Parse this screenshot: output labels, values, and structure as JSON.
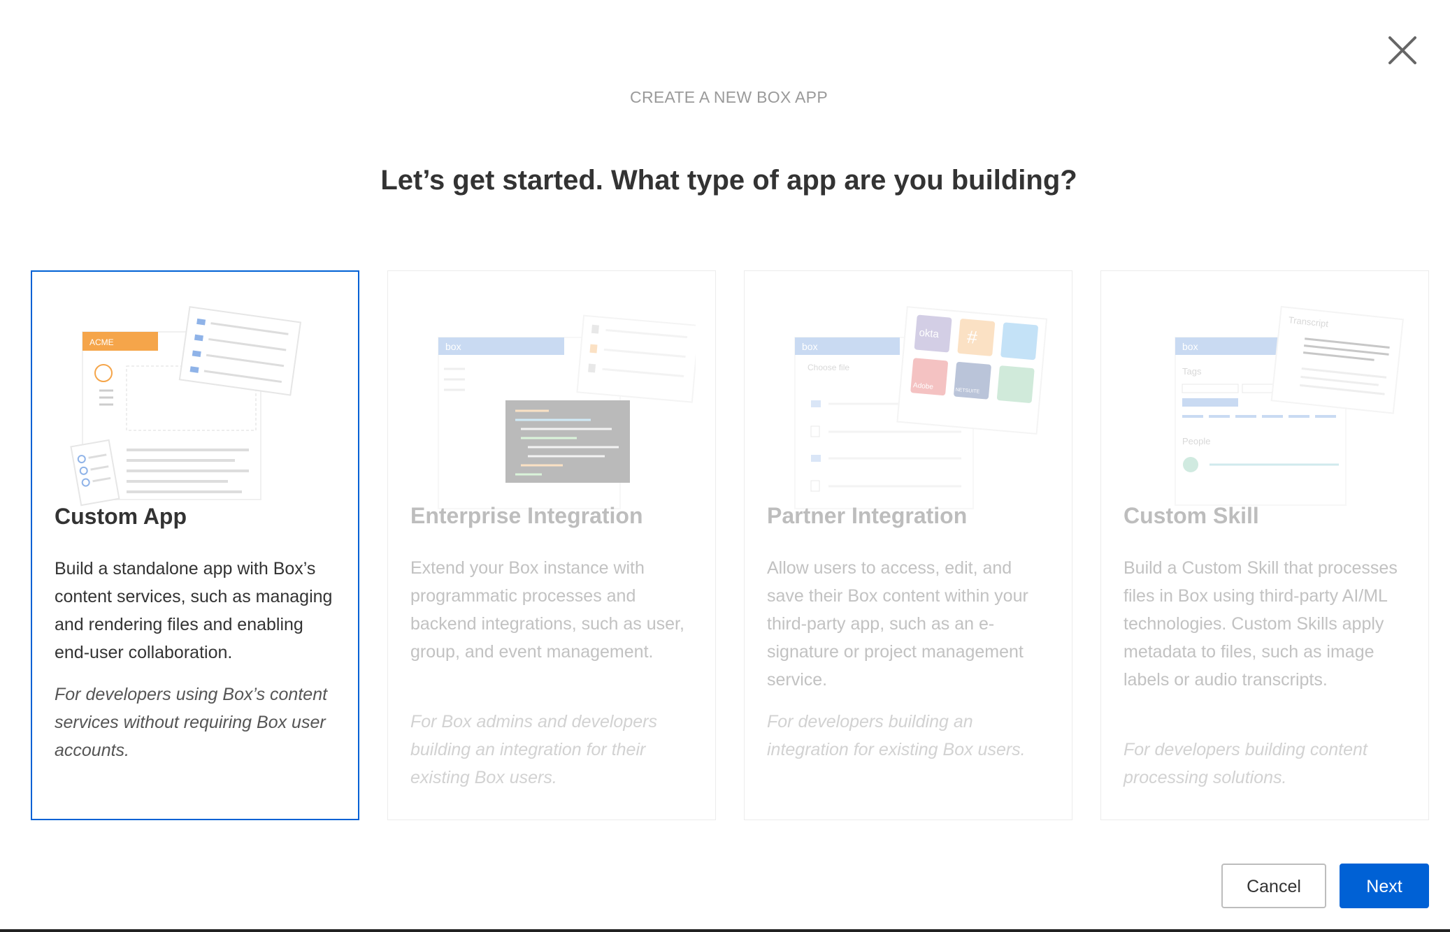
{
  "dialog": {
    "kicker": "CREATE A NEW BOX APP",
    "headline": "Let’s get started. What type of app are you building?",
    "close_icon": "close-icon"
  },
  "cards": [
    {
      "title": "Custom App",
      "description": "Build a standalone app with Box’s content services, such as managing and rendering files and enabling end-user collaboration.",
      "note": "For developers using Box’s content services without requiring Box user accounts.",
      "selected": true,
      "illustration_text": "ACME"
    },
    {
      "title": "Enterprise Integration",
      "description": "Extend your Box instance with programmatic processes and backend integrations, such as user, group, and event management.",
      "note": "For Box admins and developers building an integration for their existing Box users.",
      "selected": false,
      "illustration_text": "box"
    },
    {
      "title": "Partner Integration",
      "description": "Allow users to access, edit, and save their Box content within your third-party app, such as an e-signature or project management service.",
      "note": "For developers building an integration for existing Box users.",
      "selected": false,
      "illustration_text": "box",
      "illustration_labels": [
        "Choose file",
        "okta",
        "Adobe",
        "NETSUITE"
      ]
    },
    {
      "title": "Custom Skill",
      "description": "Build a Custom Skill that processes files in Box using third-party AI/ML technologies. Custom Skills apply metadata to files, such as image labels or audio transcripts.",
      "note": "For developers building content processing solutions.",
      "selected": false,
      "illustration_text": "box",
      "illustration_labels": [
        "Transcript",
        "Tags",
        "People"
      ]
    }
  ],
  "footer": {
    "cancel_label": "Cancel",
    "next_label": "Next"
  },
  "colors": {
    "accent": "#0061d5",
    "acme_orange": "#f5a54a",
    "box_blue": "#5a8fd8",
    "code_bg": "#2d2d2d"
  }
}
